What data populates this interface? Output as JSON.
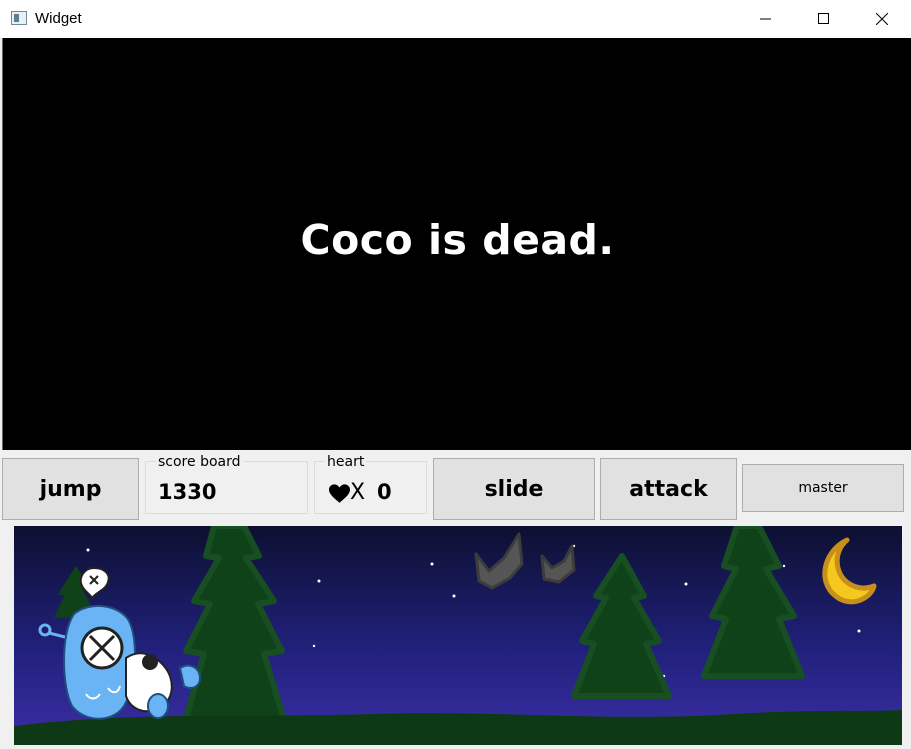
{
  "window": {
    "title": "Widget"
  },
  "game": {
    "message": "Coco is dead."
  },
  "controls": {
    "jump_label": "jump",
    "score_board": {
      "label": "score board",
      "value": "1330"
    },
    "heart": {
      "label": "heart",
      "prefix": "X",
      "value": "0"
    },
    "slide_label": "slide",
    "attack_label": "attack",
    "master_label": "master"
  },
  "colors": {
    "sky_top": "#0d1030",
    "sky_bottom": "#3b2ea6",
    "tree": "#0f4218",
    "ground": "#0d3a14",
    "character": "#6ab4f5",
    "moon": "#f5c81e"
  }
}
